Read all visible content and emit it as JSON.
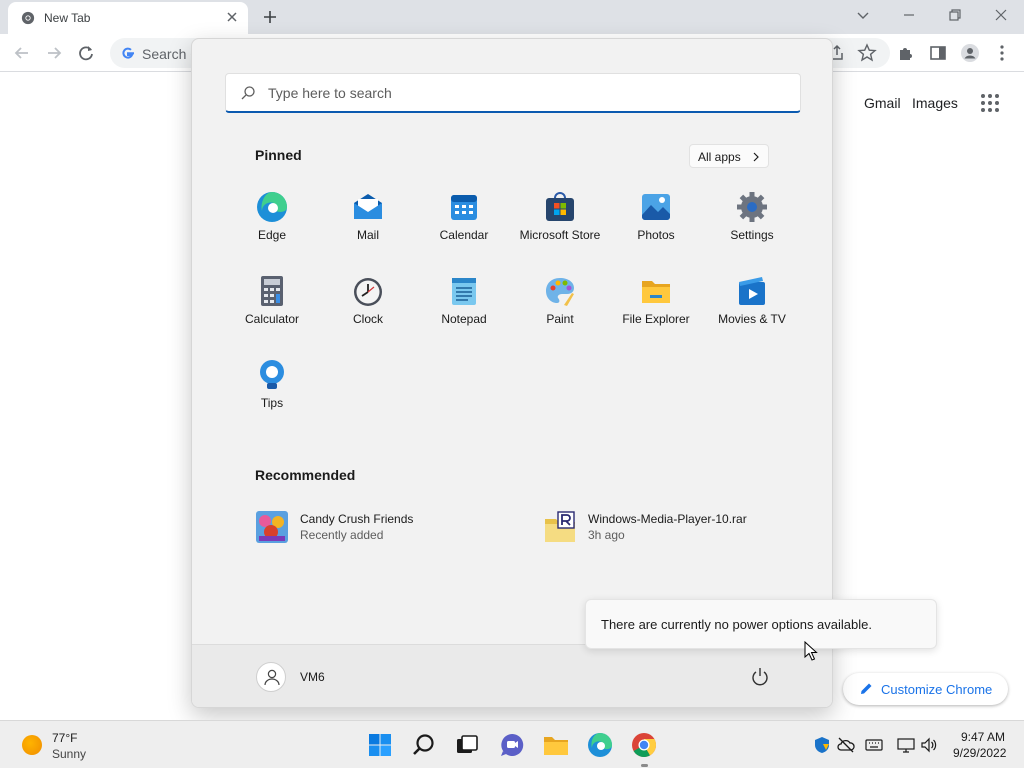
{
  "browser": {
    "tab_title": "New Tab",
    "omnibox_placeholder": "Search G",
    "links": {
      "gmail": "Gmail",
      "images": "Images"
    },
    "customize_label": "Customize Chrome"
  },
  "start_menu": {
    "search_placeholder": "Type here to search",
    "pinned_heading": "Pinned",
    "all_apps_label": "All apps",
    "pinned": [
      {
        "label": "Edge",
        "icon": "edge-icon"
      },
      {
        "label": "Mail",
        "icon": "mail-icon"
      },
      {
        "label": "Calendar",
        "icon": "calendar-icon"
      },
      {
        "label": "Microsoft Store",
        "icon": "store-icon"
      },
      {
        "label": "Photos",
        "icon": "photos-icon"
      },
      {
        "label": "Settings",
        "icon": "settings-gear-icon"
      },
      {
        "label": "Calculator",
        "icon": "calculator-icon"
      },
      {
        "label": "Clock",
        "icon": "clock-icon"
      },
      {
        "label": "Notepad",
        "icon": "notepad-icon"
      },
      {
        "label": "Paint",
        "icon": "paint-palette-icon"
      },
      {
        "label": "File Explorer",
        "icon": "folder-icon"
      },
      {
        "label": "Movies & TV",
        "icon": "movies-play-icon"
      },
      {
        "label": "Tips",
        "icon": "lightbulb-icon"
      }
    ],
    "recommended_heading": "Recommended",
    "recommended": [
      {
        "title": "Candy Crush Friends",
        "subtitle": "Recently added",
        "icon": "candy-crush-icon"
      },
      {
        "title": "Windows-Media-Player-10.rar",
        "subtitle": "3h ago",
        "icon": "rar-archive-icon"
      }
    ],
    "user_name": "VM6",
    "power_tooltip": "There are currently no power options available."
  },
  "taskbar": {
    "weather_temp": "77°F",
    "weather_condition": "Sunny",
    "time": "9:47 AM",
    "date": "9/29/2022"
  },
  "colors": {
    "accent_blue": "#0b5ab0",
    "chrome_link_blue": "#1a73e8",
    "tabstrip_gray": "#dee1e6"
  }
}
